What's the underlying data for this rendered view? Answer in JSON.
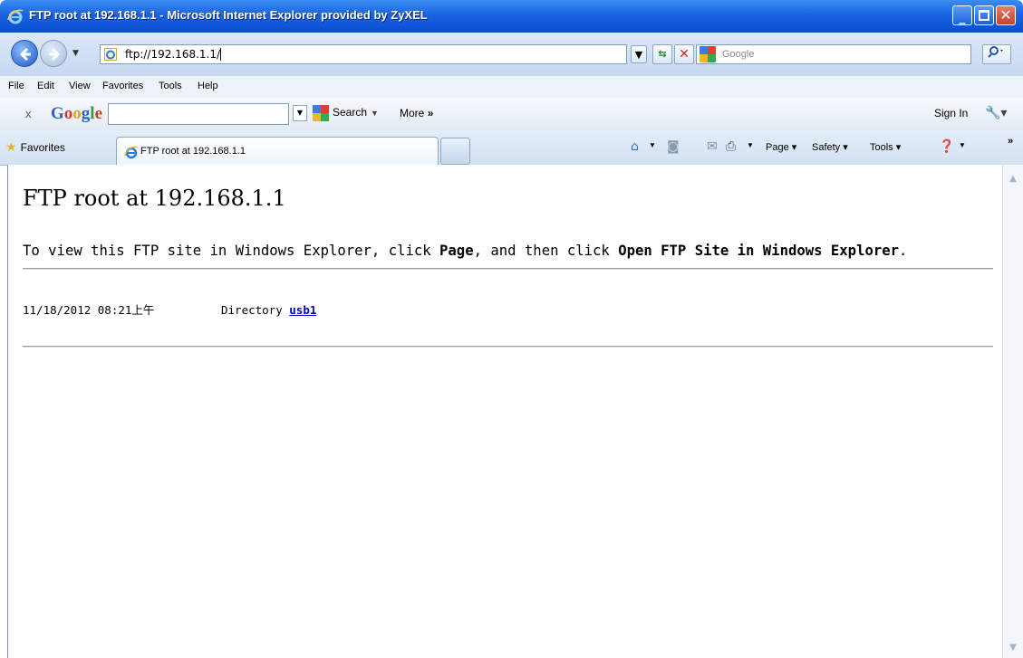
{
  "window": {
    "title": "FTP root at 192.168.1.1 - Microsoft Internet Explorer provided by ZyXEL",
    "min_glyph": "_",
    "close_glyph": "✕"
  },
  "address_bar": {
    "url": "ftp://192.168.1.1/",
    "search_placeholder": "Google"
  },
  "menu": {
    "items": [
      "File",
      "Edit",
      "View",
      "Favorites",
      "Tools",
      "Help"
    ]
  },
  "google_toolbar": {
    "close_label": "x",
    "logo": "Google",
    "search_button_label": "Search",
    "more_label": "More",
    "more_glyph": "»",
    "sign_in_label": "Sign In"
  },
  "favorites_bar": {
    "favorites_label": "Favorites",
    "tab_label": "FTP root at 192.168.1.1",
    "commands": {
      "page": "Page",
      "safety": "Safety",
      "tools": "Tools"
    }
  },
  "page": {
    "heading": "FTP root at 192.168.1.1",
    "instruction_prefix": "To view this FTP site in Windows Explorer, click ",
    "instruction_page": "Page",
    "instruction_middle": ", and then click ",
    "instruction_open": "Open FTP Site in Windows Explorer",
    "instruction_suffix": ".",
    "listing": [
      {
        "datetime": "11/18/2012 08:21上午",
        "type": "Directory",
        "name": "usb1"
      }
    ]
  },
  "colors": {
    "titlebar": "#0a4fd1",
    "link": "#0000cc"
  },
  "icons": [
    "ie-logo-icon",
    "back-arrow-icon",
    "forward-arrow-icon",
    "refresh-icon",
    "stop-icon",
    "search-icon",
    "home-icon",
    "feeds-icon",
    "mail-icon",
    "print-icon",
    "help-icon",
    "star-icon",
    "wrench-icon"
  ]
}
